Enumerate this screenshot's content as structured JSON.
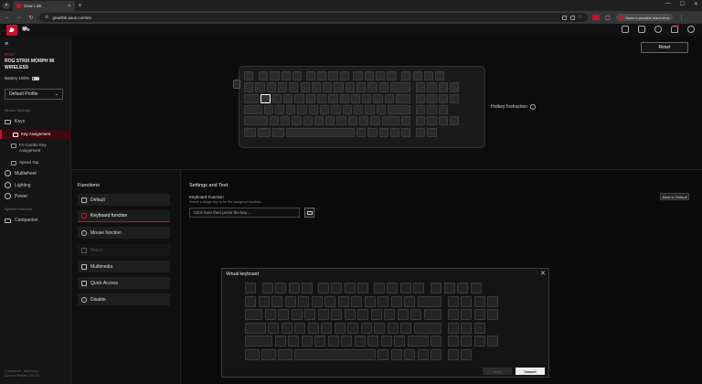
{
  "browser": {
    "tab_title": "Gear Link",
    "url": "gearlink.asus.com/en",
    "profile_label": "Ожно в режиме инкогнито"
  },
  "header": {
    "reset_label": "Reset"
  },
  "sidebar": {
    "brand": "ROG",
    "device_name": "ROG STRIX MORPH 96 WIRELESS",
    "battery": "Battery 100%",
    "profile": "Default Profile",
    "device_settings_label": "Device Settings",
    "keys_label": "Keys",
    "key_assignment_label": "Key Assignment",
    "combo_key_label": "Fn Combo Key Assignment",
    "speed_tap_label": "Speed Tap",
    "multiwheel_label": "Multiwheel",
    "lighting_label": "Lighting",
    "power_label": "Power",
    "system_features_label": "System Features",
    "companion_label": "Companion",
    "footer_line1": "Companion · Arduinkey...",
    "footer_line2": "Current Version: 1.00.02"
  },
  "keyboard": {
    "hotkey_label": "Hotkey Instruction",
    "selected_key": "Q"
  },
  "functions": {
    "title": "Functions",
    "items": [
      "Default",
      "Keyboard function",
      "Mouse function",
      "Macro",
      "Multimedia",
      "Quick Access",
      "Disable"
    ]
  },
  "settings": {
    "title": "Settings and Test",
    "kb_fn_label": "Keyboard Function",
    "kb_fn_desc": "Select a single key to be the assigned function.",
    "input_placeholder": "Click here then press the key...",
    "back_default_label": "Back to Default"
  },
  "virtual_keyboard": {
    "title": "Virtual keyboard",
    "apply_label": "Apply",
    "cancel_label": "Cancel"
  }
}
